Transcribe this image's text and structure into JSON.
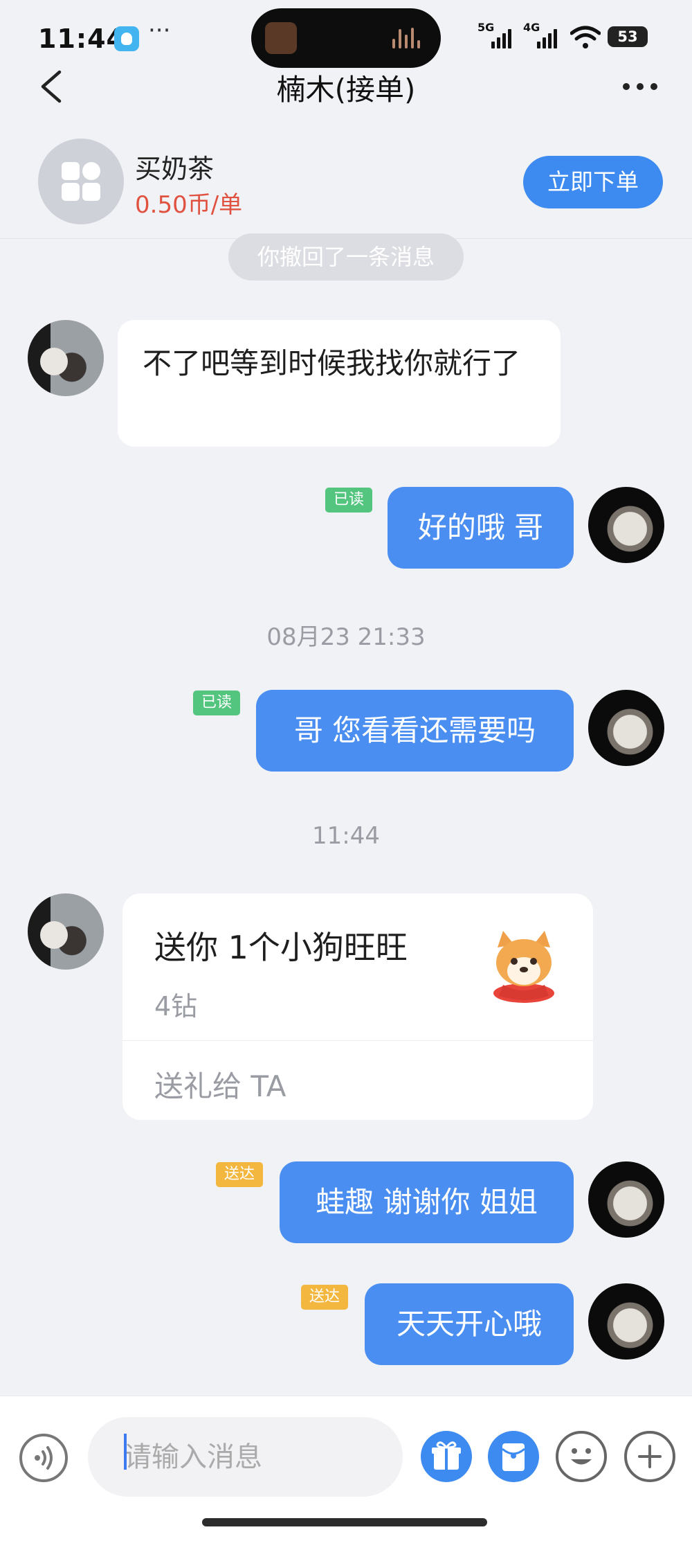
{
  "status_bar": {
    "time": "11:44",
    "overflow": "···",
    "network_1": "5G",
    "network_2": "4G",
    "battery": "53",
    "icons": [
      "app-notification-icon",
      "signal-icon",
      "wifi-icon",
      "battery-icon"
    ]
  },
  "header": {
    "title": "楠木(接单)",
    "icons": [
      "back-arrow-icon",
      "more-dots-icon"
    ]
  },
  "service": {
    "name": "买奶茶",
    "price": "0.50币/单",
    "order_button": "立即下单",
    "icon": "grid-apps-icon"
  },
  "chat": {
    "recall_notice": "你撤回了一条消息",
    "messages": [
      {
        "side": "other",
        "text": "不了吧等到时候我找你就行了"
      },
      {
        "side": "me",
        "text": "好的哦 哥",
        "status": "已读"
      },
      {
        "side": "me",
        "text": "哥 您看看还需要吗",
        "status": "已读"
      },
      {
        "side": "me",
        "text": "蛙趣 谢谢你 姐姐",
        "status": "送达"
      },
      {
        "side": "me",
        "text": "天天开心哦",
        "status": "送达"
      }
    ],
    "timestamps": [
      "08月23 21:33",
      "11:44"
    ],
    "gift": {
      "title": "送你 1个小狗旺旺",
      "price": "4钻",
      "action": "送礼给 TA",
      "image_icon": "corgi-gift-icon"
    }
  },
  "input_bar": {
    "placeholder": "请输入消息",
    "icons": [
      "voice-icon",
      "gift-icon",
      "red-envelope-icon",
      "emoji-icon",
      "plus-icon"
    ]
  },
  "colors": {
    "accent": "#4a8ef2",
    "price": "#e0523f",
    "read_tag": "#54c57f",
    "sent_tag": "#f3b63f",
    "background": "#f1f2f6"
  }
}
